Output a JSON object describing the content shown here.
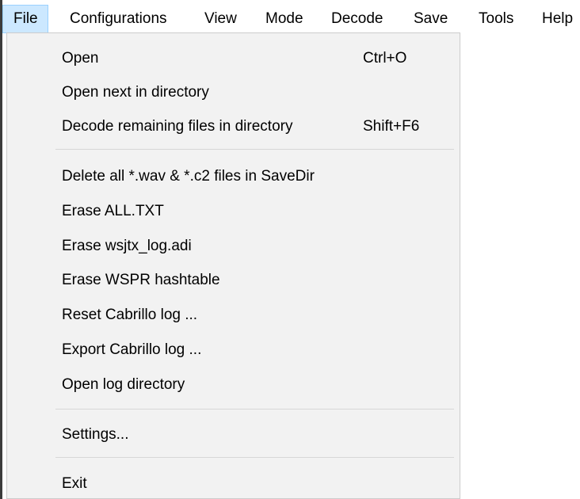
{
  "menubar": {
    "items": [
      {
        "label": "File",
        "active": true
      },
      {
        "label": "Configurations"
      },
      {
        "label": "View"
      },
      {
        "label": "Mode"
      },
      {
        "label": "Decode"
      },
      {
        "label": "Save"
      },
      {
        "label": "Tools"
      },
      {
        "label": "Help"
      }
    ]
  },
  "file_menu": {
    "items": [
      {
        "label": "Open",
        "shortcut": "Ctrl+O"
      },
      {
        "label": "Open next in directory",
        "shortcut": ""
      },
      {
        "label": "Decode remaining files in directory",
        "shortcut": "Shift+F6"
      },
      {
        "label": "Delete all *.wav & *.c2 files in SaveDir",
        "shortcut": ""
      },
      {
        "label": "Erase ALL.TXT",
        "shortcut": ""
      },
      {
        "label": "Erase wsjtx_log.adi",
        "shortcut": ""
      },
      {
        "label": "Erase WSPR hashtable",
        "shortcut": ""
      },
      {
        "label": "Reset Cabrillo log ...",
        "shortcut": ""
      },
      {
        "label": "Export Cabrillo log ...",
        "shortcut": ""
      },
      {
        "label": "Open log directory",
        "shortcut": ""
      },
      {
        "label": "Settings...",
        "shortcut": ""
      },
      {
        "label": "Exit",
        "shortcut": ""
      }
    ]
  },
  "colors": {
    "menubar_bg": "#ffffff",
    "active_highlight": "#cce8ff",
    "active_border": "#99d1ff",
    "dropdown_bg": "#f2f2f2",
    "separator": "#d7d7d7"
  }
}
